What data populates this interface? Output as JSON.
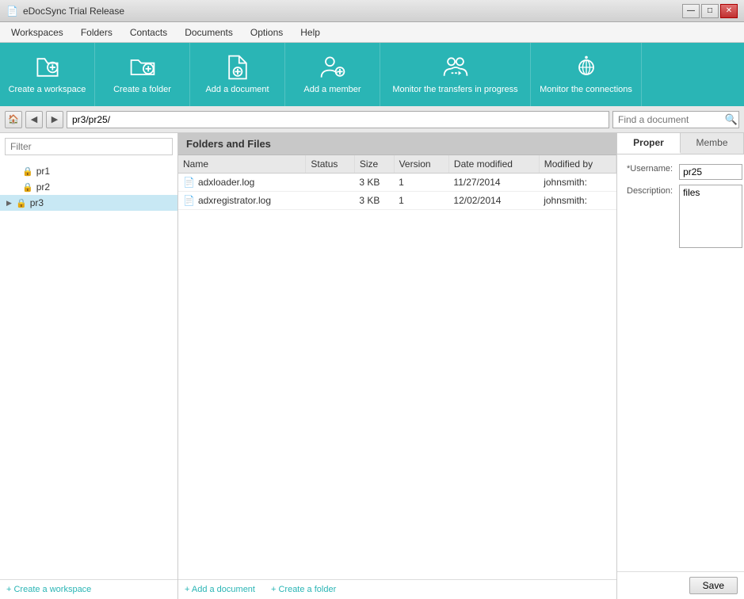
{
  "titlebar": {
    "title": "eDocSync Trial Release",
    "app_icon": "📄",
    "controls": {
      "minimize": "—",
      "maximize": "□",
      "close": "✕"
    }
  },
  "menubar": {
    "items": [
      {
        "id": "workspaces",
        "label": "Workspaces"
      },
      {
        "id": "folders",
        "label": "Folders"
      },
      {
        "id": "contacts",
        "label": "Contacts"
      },
      {
        "id": "documents",
        "label": "Documents"
      },
      {
        "id": "options",
        "label": "Options"
      },
      {
        "id": "help",
        "label": "Help"
      }
    ]
  },
  "toolbar": {
    "buttons": [
      {
        "id": "create-workspace",
        "label": "Create a workspace",
        "icon": "workspace"
      },
      {
        "id": "create-folder",
        "label": "Create a folder",
        "icon": "folder"
      },
      {
        "id": "add-document",
        "label": "Add a document",
        "icon": "document"
      },
      {
        "id": "add-member",
        "label": "Add a member",
        "icon": "member"
      },
      {
        "id": "monitor-transfers",
        "label": "Monitor the transfers in progress",
        "icon": "transfers"
      },
      {
        "id": "monitor-connections",
        "label": "Monitor the connections",
        "icon": "connections"
      }
    ]
  },
  "addressbar": {
    "path": "pr3/pr25/",
    "search_placeholder": "Find a document",
    "nav_home_title": "Home",
    "nav_back_title": "Back",
    "nav_forward_title": "Forward"
  },
  "sidebar": {
    "filter_placeholder": "Filter",
    "tree": [
      {
        "id": "pr1",
        "label": "pr1",
        "locked": true,
        "level": 1,
        "has_arrow": false
      },
      {
        "id": "pr2",
        "label": "pr2",
        "locked": true,
        "level": 1,
        "has_arrow": false
      },
      {
        "id": "pr3",
        "label": "pr3",
        "locked": true,
        "level": 1,
        "has_arrow": true,
        "expanded": true
      }
    ],
    "footer_label": "+ Create a workspace"
  },
  "main": {
    "folders_header": "Folders and Files",
    "table": {
      "columns": [
        "Name",
        "Status",
        "Size",
        "Version",
        "Date modified",
        "Modified by"
      ],
      "rows": [
        {
          "name": "adxloader.log",
          "status": "",
          "size": "3 KB",
          "version": "1",
          "date_modified": "11/27/2014",
          "modified_by": "johnsmith:"
        },
        {
          "name": "adxregistrator.log",
          "status": "",
          "size": "3 KB",
          "version": "1",
          "date_modified": "12/02/2014",
          "modified_by": "johnsmith:"
        }
      ]
    },
    "footer": {
      "add_document": "+ Add a document",
      "create_folder": "+ Create a folder"
    }
  },
  "right_panel": {
    "tabs": [
      {
        "id": "properties",
        "label": "Proper",
        "active": true
      },
      {
        "id": "members",
        "label": "Membe",
        "active": false
      }
    ],
    "properties": {
      "username_label": "*Username:",
      "username_value": "pr25",
      "description_label": "Description:",
      "description_value": "files"
    },
    "save_label": "Save"
  }
}
